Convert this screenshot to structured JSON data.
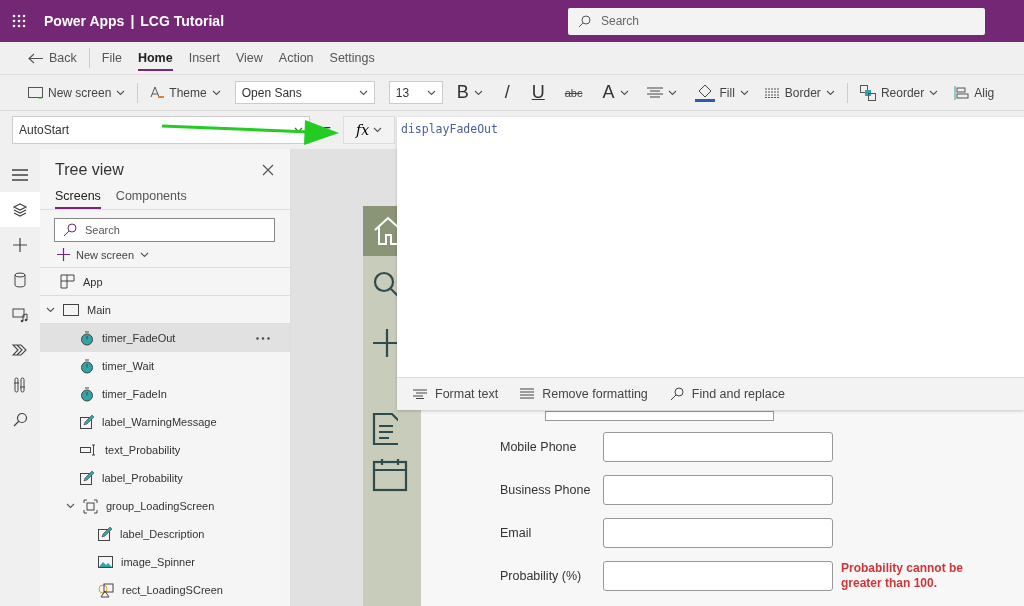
{
  "header": {
    "app_name": "Power Apps",
    "separator": "|",
    "project": "LCG Tutorial",
    "search": {
      "placeholder": "Search"
    }
  },
  "menu": {
    "back": "Back",
    "items": [
      {
        "label": "File",
        "selected": false
      },
      {
        "label": "Home",
        "selected": true
      },
      {
        "label": "Insert",
        "selected": false
      },
      {
        "label": "View",
        "selected": false
      },
      {
        "label": "Action",
        "selected": false
      },
      {
        "label": "Settings",
        "selected": false
      }
    ]
  },
  "toolbar": {
    "new_screen": "New screen",
    "theme": "Theme",
    "font": "Open Sans",
    "size": "13",
    "bold": "B",
    "italic": "/",
    "underline": "U",
    "strike": "abc",
    "font_color": "A",
    "fill": "Fill",
    "border": "Border",
    "reorder": "Reorder",
    "align": "Alig"
  },
  "formula_bar": {
    "property": "AutoStart",
    "equals": "=",
    "fx": "fx",
    "formula": "displayFadeOut",
    "actions": [
      "Format text",
      "Remove formatting",
      "Find and replace"
    ]
  },
  "rail": [
    {
      "kind": "menu",
      "selected": false
    },
    {
      "kind": "layers",
      "selected": true
    },
    {
      "kind": "plus",
      "selected": false
    },
    {
      "kind": "data",
      "selected": false
    },
    {
      "kind": "media",
      "selected": false
    },
    {
      "kind": "components",
      "selected": false
    },
    {
      "kind": "tools",
      "selected": false
    },
    {
      "kind": "search",
      "selected": false
    }
  ],
  "tree_view": {
    "title": "Tree view",
    "tabs": [
      {
        "label": "Screens",
        "selected": true
      },
      {
        "label": "Components",
        "selected": false
      }
    ],
    "search": {
      "placeholder": "Search"
    },
    "new_screen": "New screen",
    "items": [
      {
        "label": "App",
        "kind": "app",
        "selected": false
      },
      {
        "label": "Main",
        "kind": "screen",
        "selected": false,
        "expanded": true,
        "children": [
          {
            "label": "timer_FadeOut",
            "kind": "timer",
            "selected": true
          },
          {
            "label": "timer_Wait",
            "kind": "timer",
            "selected": false
          },
          {
            "label": "timer_FadeIn",
            "kind": "timer",
            "selected": false
          },
          {
            "label": "label_WarningMessage",
            "kind": "label",
            "selected": false
          },
          {
            "label": "text_Probability",
            "kind": "textinput",
            "selected": false
          },
          {
            "label": "label_Probability",
            "kind": "label",
            "selected": false
          },
          {
            "label": "group_LoadingScreen",
            "kind": "group",
            "selected": false,
            "expanded": true,
            "children": [
              {
                "label": "label_Description",
                "kind": "label",
                "selected": false
              },
              {
                "label": "image_Spinner",
                "kind": "image",
                "selected": false
              },
              {
                "label": "rect_LoadingSCreen",
                "kind": "rect",
                "selected": false
              }
            ]
          }
        ]
      }
    ]
  },
  "canvas": {
    "nav": [
      {
        "kind": "home",
        "selected": true
      },
      {
        "kind": "search",
        "selected": false
      },
      {
        "kind": "plus",
        "selected": false
      },
      {
        "kind": "document",
        "selected": false
      },
      {
        "kind": "calendar",
        "selected": false
      }
    ],
    "fields": [
      {
        "label": "Mobile Phone"
      },
      {
        "label": "Business Phone"
      },
      {
        "label": "Email"
      },
      {
        "label": "Probability (%)",
        "error": "Probability cannot be greater than 100."
      }
    ]
  }
}
